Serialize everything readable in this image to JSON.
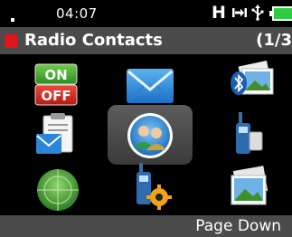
{
  "status_bar": {
    "time": "04:07",
    "network": "H",
    "icons": [
      "signal-dot-icon",
      "bluetooth-transfer-icon",
      "usb-icon",
      "battery-icon"
    ],
    "battery_color": "#2ecc40"
  },
  "header": {
    "title": "Radio Contacts",
    "page": "(1/3",
    "accent_color": "#e0141d"
  },
  "menu": {
    "items": [
      {
        "icon": "on-off-icon",
        "on_label": "ON",
        "off_label": "OFF"
      },
      {
        "icon": "message-envelope-icon"
      },
      {
        "icon": "bluetooth-gallery-icon"
      },
      {
        "icon": "clipboard-message-icon"
      },
      {
        "icon": "radio-contacts-icon",
        "selected": true
      },
      {
        "icon": "radio-device-icon"
      },
      {
        "icon": "radar-icon"
      },
      {
        "icon": "radio-settings-icon"
      },
      {
        "icon": "gallery-icon"
      }
    ]
  },
  "softkeys": {
    "right": "Page Down"
  }
}
